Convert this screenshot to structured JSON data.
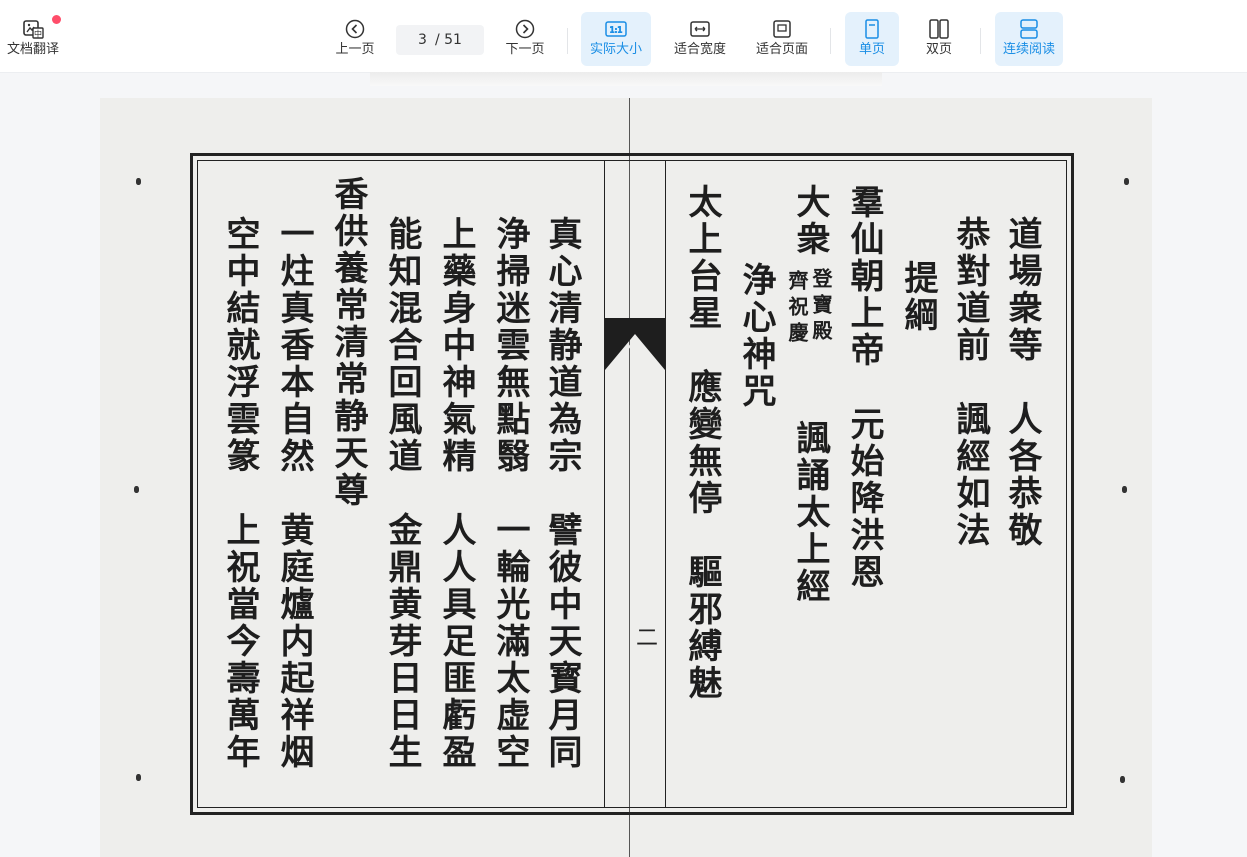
{
  "toolbar": {
    "translate_label": "文档翻译",
    "prev_label": "上一页",
    "next_label": "下一页",
    "page_current": "3",
    "page_total": "/ 51",
    "actual_size_label": "实际大小",
    "actual_size_icon_text": "1:1",
    "fit_width_label": "适合宽度",
    "fit_page_label": "适合页面",
    "single_page_label": "单页",
    "double_page_label": "双页",
    "continuous_label": "连续阅读"
  },
  "colors": {
    "accent": "#1a8ee5",
    "active_bg": "#e4f1fc",
    "badge": "#ff4d6a"
  },
  "document": {
    "page_number_mark": "二",
    "right_page_columns": [
      "道場衆等　人各恭敬",
      "恭對道前　諷經如法",
      "提綱",
      "羣仙朝上帝　元始降洪恩",
      "大衆",
      "登寶殿",
      "齊祝慶",
      "諷誦太上經",
      "浄心神咒",
      "太上台星　應變無停　驅邪縛魅"
    ],
    "left_page_columns": [
      "真心清静道為宗　譬彼中天寳月同",
      "浄掃迷雲無點翳　一輪光滿太虚空",
      "上藥身中神氣精　人人具足匪虧盈",
      "能知混合回風道　金鼎黄芽日日生",
      "香供養常清常静天尊",
      "一炷真香本自然　黄庭爐内起祥烟",
      "空中結就浮雲篆　上祝當今壽萬年"
    ]
  }
}
